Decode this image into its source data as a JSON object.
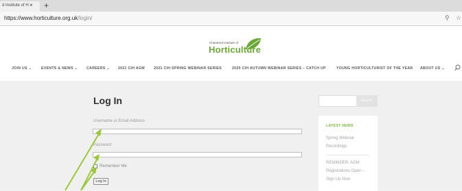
{
  "browser": {
    "tab_title": "d Institute of H",
    "tab_close": "×",
    "new_tab": "+",
    "url_host": "https://www.horticulture.org.uk",
    "url_path": "/login/"
  },
  "site": {
    "logo_small": "Chartered Institute of",
    "logo_big": "Horticulture",
    "nav": [
      {
        "label": "JOIN US ⌄"
      },
      {
        "label": "EVENTS & NEWS ⌄"
      },
      {
        "label": "CAREERS ⌄"
      },
      {
        "label": "2021 CIH AGM"
      },
      {
        "label": "2021 CIH SPRING WEBINAR SERIES"
      },
      {
        "label": "2020 CIH AUTUMN WEBINAR SERIES – CATCH UP"
      },
      {
        "label": "YOUNG HORTICULTURIST OF THE YEAR"
      },
      {
        "label": "ABOUT US ⌄"
      }
    ]
  },
  "login": {
    "title": "Log In",
    "username_label": "Username or Email Address",
    "password_label": "Password",
    "remember_label": "Remember Me",
    "submit_label": "Log In"
  },
  "sidebar": {
    "search_button": "Search",
    "latest_title": "LATEST NEWS",
    "news": [
      {
        "line1": "Spring Webinar",
        "line2": "Recordings",
        "line3": ""
      },
      {
        "line1": "REMINDER: AGM",
        "line2": "Registrations Open –",
        "line3": "Sign Up Now"
      }
    ]
  },
  "colors": {
    "brand_green": "#6aa835",
    "annotation_arrow": "#9bc83a"
  },
  "icons": {
    "address_key": "key-icon",
    "address_star": "favorite-icon",
    "nav_search": "search-icon"
  }
}
